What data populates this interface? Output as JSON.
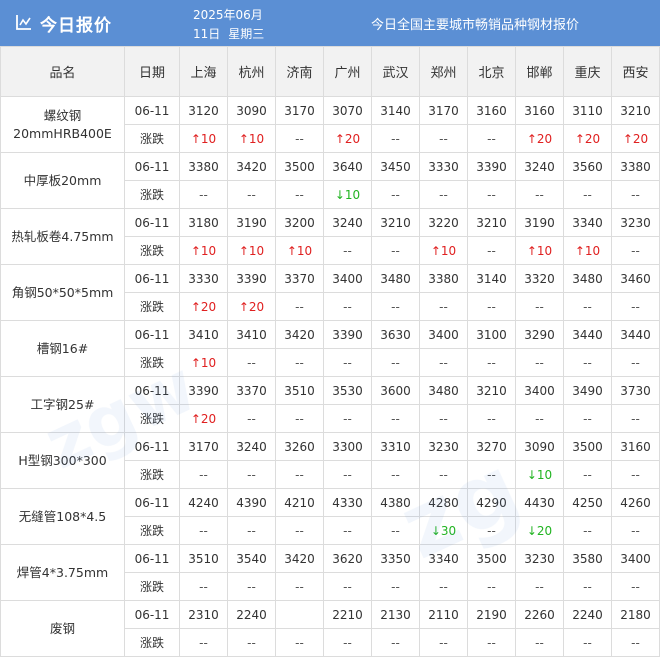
{
  "header": {
    "title": "今日报价",
    "date_year_month": "2025年06月",
    "date_day": "11日",
    "weekday": "星期三",
    "subtitle": "今日全国主要城市畅销品种钢材报价",
    "icon": "chart-line-icon"
  },
  "table": {
    "columns": [
      "品名",
      "日期",
      "上海",
      "杭州",
      "济南",
      "广州",
      "武汉",
      "郑州",
      "北京",
      "邯郸",
      "重庆",
      "西安"
    ],
    "change_label": "涨跌",
    "products": [
      {
        "name": "螺纹钢\n20mmHRB400E",
        "date": "06-11",
        "prices": [
          "3120",
          "3090",
          "3170",
          "3070",
          "3140",
          "3170",
          "3160",
          "3160",
          "3110",
          "3210"
        ],
        "changes": [
          "↑10",
          "↑10",
          "--",
          "↑20",
          "--",
          "--",
          "--",
          "↑20",
          "↑20",
          "↑20"
        ]
      },
      {
        "name": "中厚板20mm",
        "date": "06-11",
        "prices": [
          "3380",
          "3420",
          "3500",
          "3640",
          "3450",
          "3330",
          "3390",
          "3240",
          "3560",
          "3380"
        ],
        "changes": [
          "--",
          "--",
          "--",
          "↓10",
          "--",
          "--",
          "--",
          "--",
          "--",
          "--"
        ]
      },
      {
        "name": "热轧板卷4.75mm",
        "date": "06-11",
        "prices": [
          "3180",
          "3190",
          "3200",
          "3240",
          "3210",
          "3220",
          "3210",
          "3190",
          "3340",
          "3230"
        ],
        "changes": [
          "↑10",
          "↑10",
          "↑10",
          "--",
          "--",
          "↑10",
          "--",
          "↑10",
          "↑10",
          "--"
        ]
      },
      {
        "name": "角钢50*50*5mm",
        "date": "06-11",
        "prices": [
          "3330",
          "3390",
          "3370",
          "3400",
          "3480",
          "3380",
          "3140",
          "3320",
          "3480",
          "3460"
        ],
        "changes": [
          "↑20",
          "↑20",
          "--",
          "--",
          "--",
          "--",
          "--",
          "--",
          "--",
          "--"
        ]
      },
      {
        "name": "槽钢16#",
        "date": "06-11",
        "prices": [
          "3410",
          "3410",
          "3420",
          "3390",
          "3630",
          "3400",
          "3100",
          "3290",
          "3440",
          "3440"
        ],
        "changes": [
          "↑10",
          "--",
          "--",
          "--",
          "--",
          "--",
          "--",
          "--",
          "--",
          "--"
        ]
      },
      {
        "name": "工字钢25#",
        "date": "06-11",
        "prices": [
          "3390",
          "3370",
          "3510",
          "3530",
          "3600",
          "3480",
          "3210",
          "3400",
          "3490",
          "3730"
        ],
        "changes": [
          "↑20",
          "--",
          "--",
          "--",
          "--",
          "--",
          "--",
          "--",
          "--",
          "--"
        ]
      },
      {
        "name": "H型钢300*300",
        "date": "06-11",
        "prices": [
          "3170",
          "3240",
          "3260",
          "3300",
          "3310",
          "3230",
          "3270",
          "3090",
          "3500",
          "3160"
        ],
        "changes": [
          "--",
          "--",
          "--",
          "--",
          "--",
          "--",
          "--",
          "↓10",
          "--",
          "--"
        ]
      },
      {
        "name": "无缝管108*4.5",
        "date": "06-11",
        "prices": [
          "4240",
          "4390",
          "4210",
          "4330",
          "4380",
          "4280",
          "4290",
          "4430",
          "4250",
          "4260"
        ],
        "changes": [
          "--",
          "--",
          "--",
          "--",
          "--",
          "↓30",
          "--",
          "↓20",
          "--",
          "--"
        ]
      },
      {
        "name": "焊管4*3.75mm",
        "date": "06-11",
        "prices": [
          "3510",
          "3540",
          "3420",
          "3620",
          "3350",
          "3340",
          "3500",
          "3230",
          "3580",
          "3400"
        ],
        "changes": [
          "--",
          "--",
          "--",
          "--",
          "--",
          "--",
          "--",
          "--",
          "--",
          "--"
        ]
      },
      {
        "name": "废钢",
        "date": "06-11",
        "prices": [
          "2310",
          "2240",
          "",
          "2210",
          "2130",
          "2110",
          "2190",
          "2260",
          "2240",
          "2180"
        ],
        "changes": [
          "--",
          "--",
          "--",
          "--",
          "--",
          "--",
          "--",
          "--",
          "--",
          "--"
        ]
      }
    ]
  },
  "colors": {
    "header_bg": "#5b8fd4",
    "up": "#e02020",
    "down": "#22b422"
  }
}
